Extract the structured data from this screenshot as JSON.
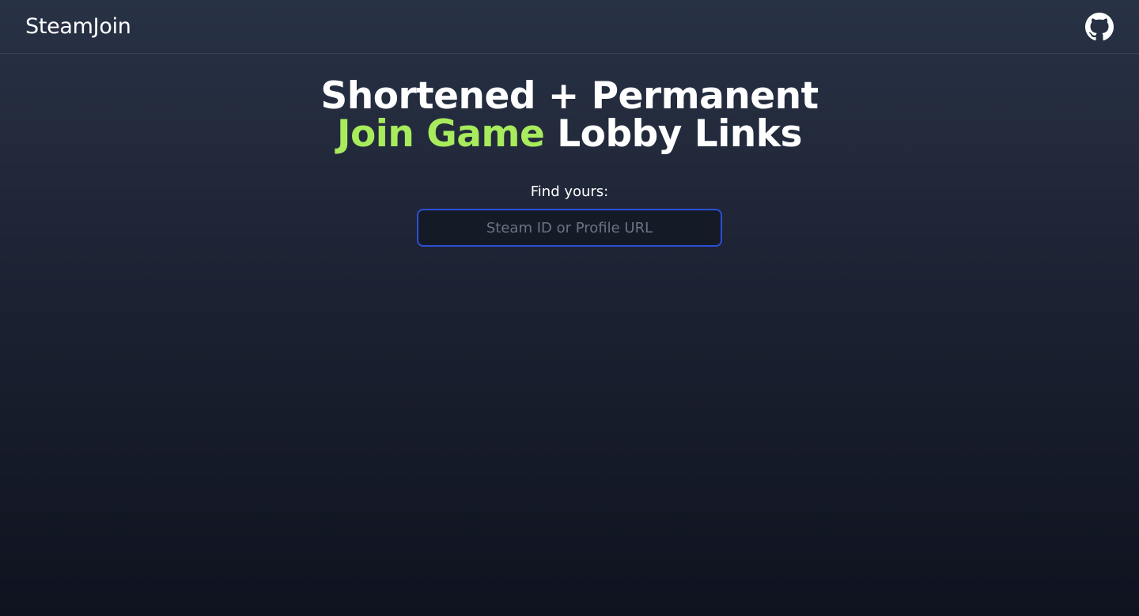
{
  "header": {
    "brand": "SteamJoin",
    "github_icon": "github-icon"
  },
  "hero": {
    "line1": "Shortened + Permanent",
    "line2_accent": "Join Game",
    "line2_rest": " Lobby Links"
  },
  "search": {
    "label": "Find yours:",
    "value": "",
    "placeholder": "Steam ID or Profile URL"
  },
  "colors": {
    "accent_green": "#a8eb5c",
    "input_border": "#2c4fd6",
    "background_top": "#283245",
    "background_bottom": "#0f1320"
  }
}
